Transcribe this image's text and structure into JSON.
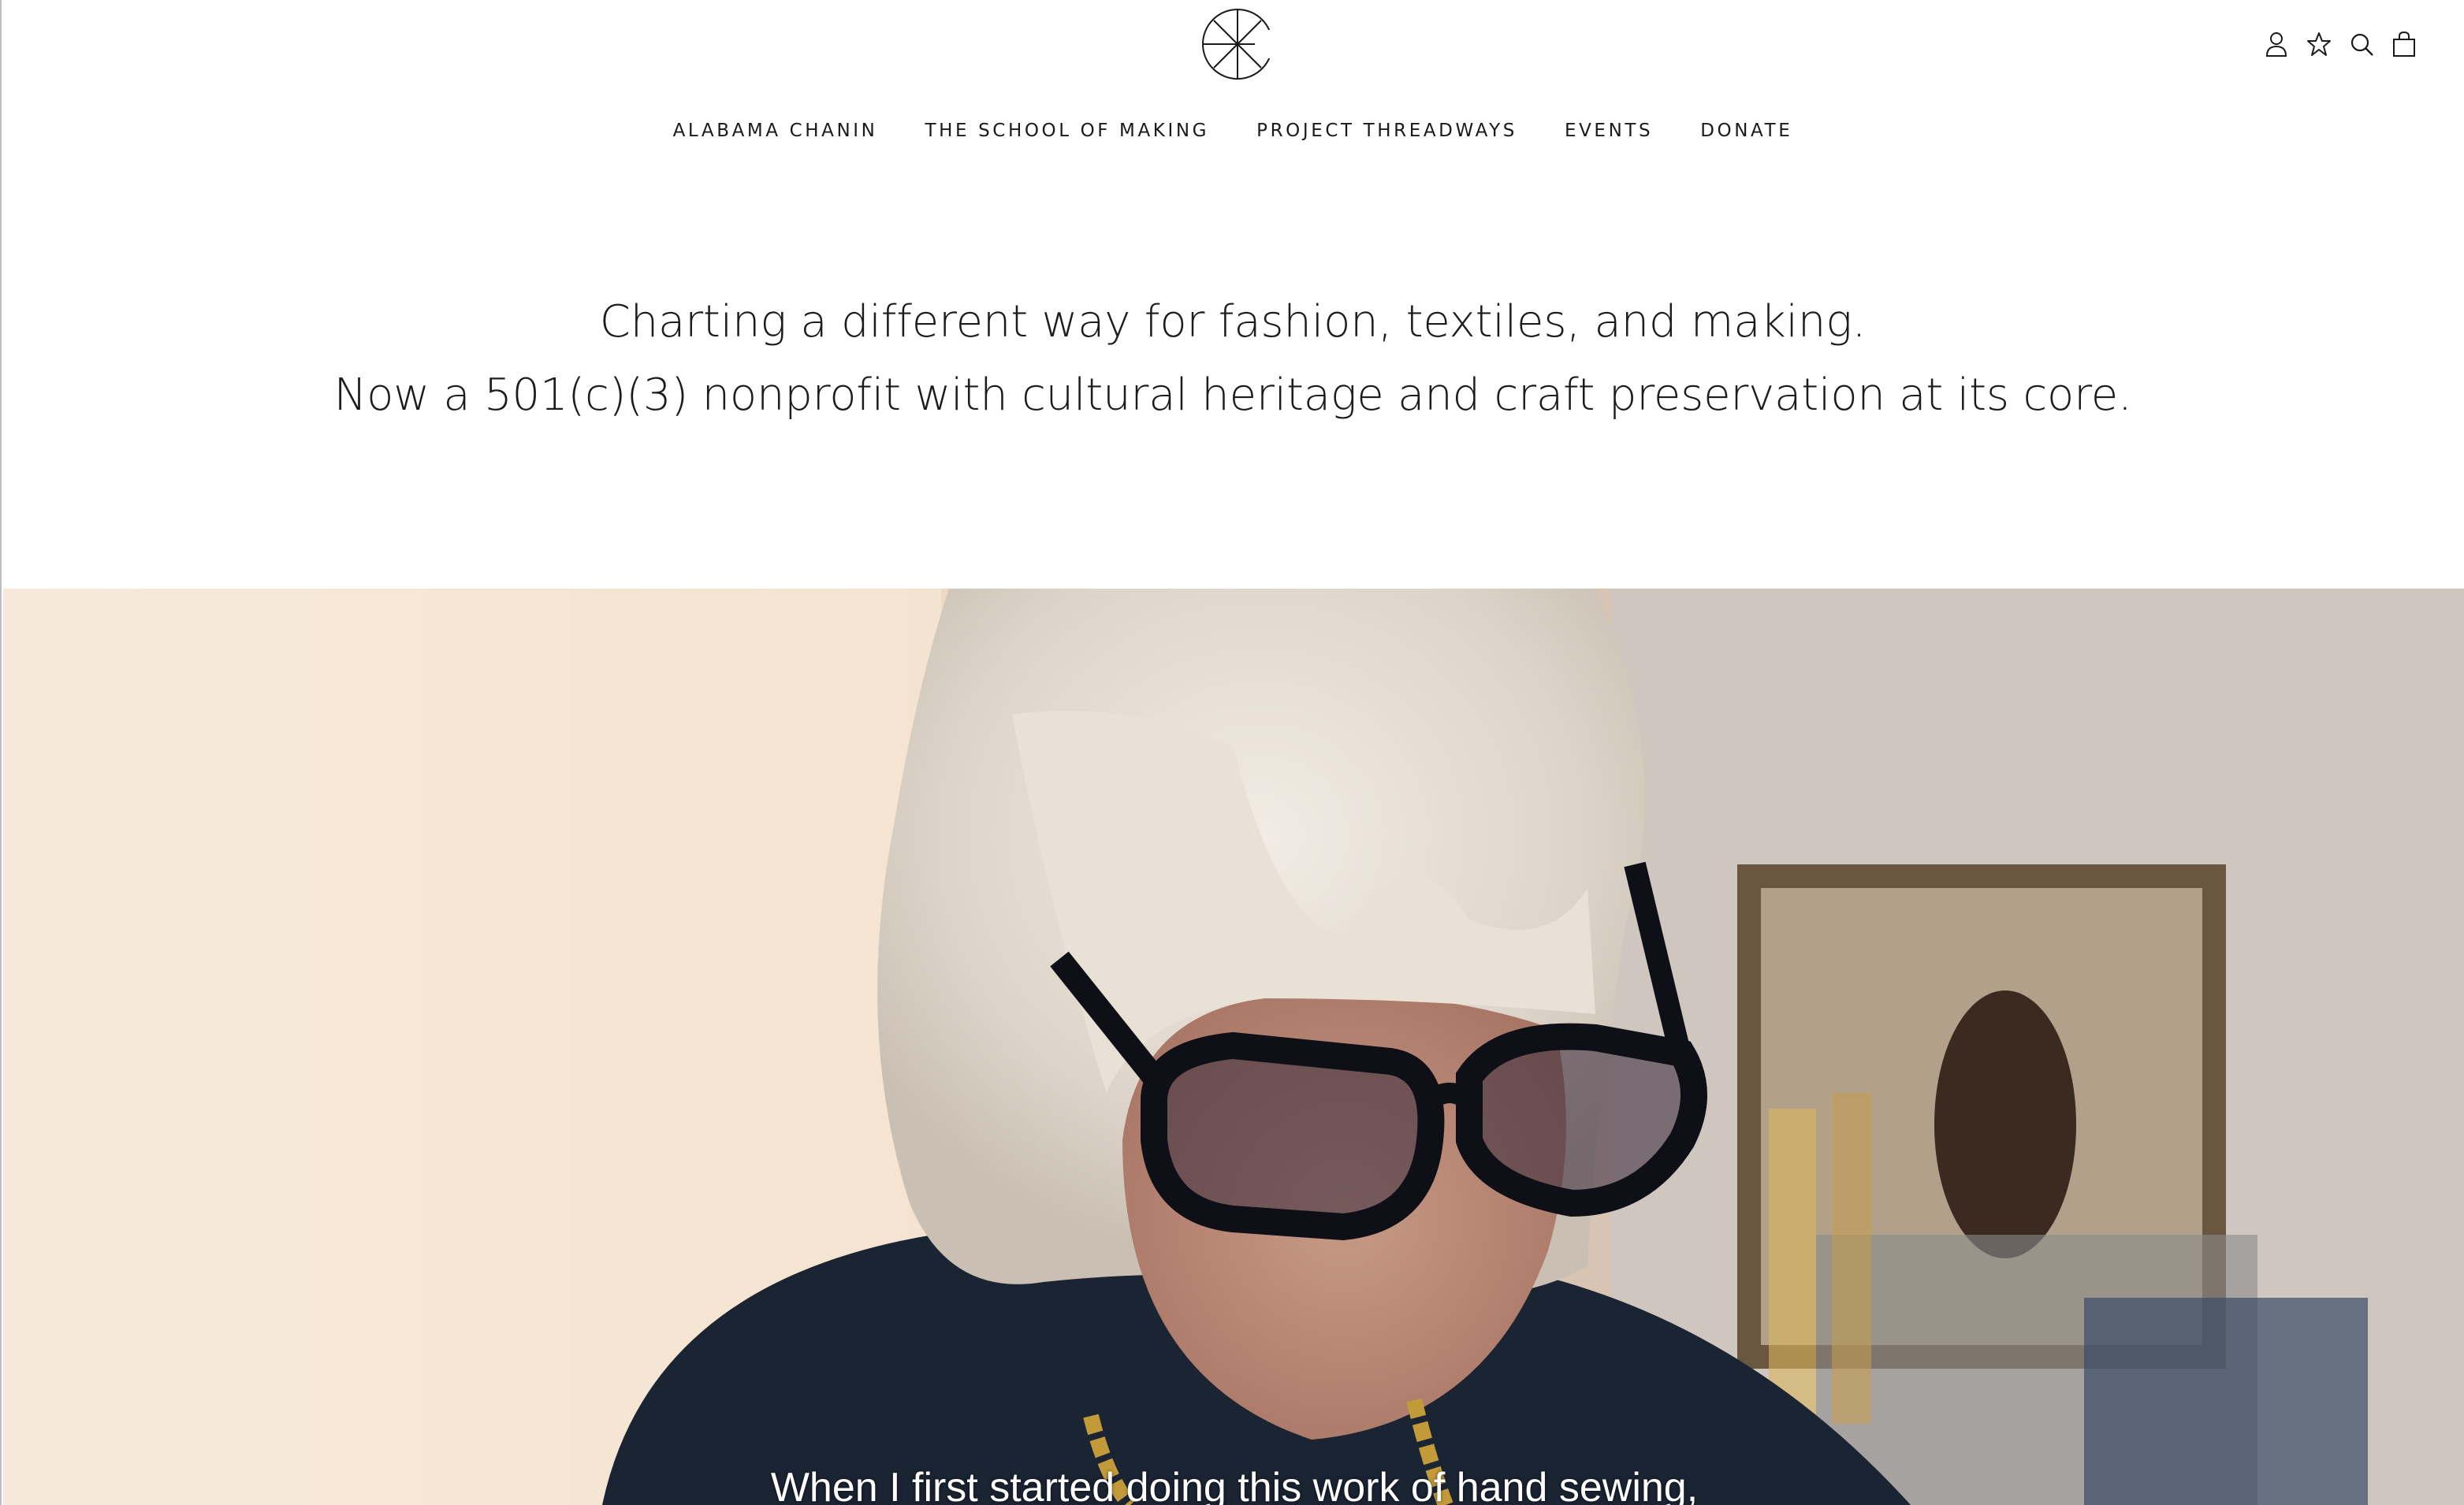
{
  "brand": {
    "logo_name": "alabama-chanin-logo"
  },
  "header": {
    "icons": [
      {
        "name": "account-icon"
      },
      {
        "name": "wishlist-star-icon"
      },
      {
        "name": "search-icon"
      },
      {
        "name": "cart-bag-icon"
      }
    ]
  },
  "nav": {
    "items": [
      {
        "label": "ALABAMA CHANIN"
      },
      {
        "label": "THE SCHOOL OF MAKING"
      },
      {
        "label": "PROJECT THREADWAYS"
      },
      {
        "label": "EVENTS"
      },
      {
        "label": "DONATE"
      }
    ]
  },
  "hero": {
    "line1": "Charting a different way for fashion, textiles, and making.",
    "line2": "Now a 501(c)(3) nonprofit with cultural heritage and craft preservation at its core."
  },
  "video": {
    "caption": "When I first started doing this work of hand sewing,"
  },
  "colors": {
    "background": "#ffffff",
    "text": "#1a1a1a",
    "caption": "#ffffff"
  }
}
